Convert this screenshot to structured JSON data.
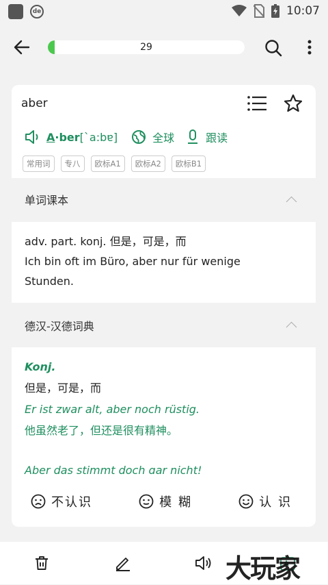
{
  "status": {
    "time": "10:07",
    "app_badge": "de"
  },
  "header": {
    "progress_count": "29",
    "progress_fraction": 0.035
  },
  "word": {
    "headword": "aber",
    "pronunciation_bold_a": "A",
    "pronunciation_rest": "·ber",
    "ipa": "[`a:bɐ]",
    "global_label": "全球",
    "follow_label": "跟读",
    "tags": [
      "常用词",
      "专八",
      "欧标A1",
      "欧标A2",
      "欧标B1"
    ]
  },
  "textbook": {
    "title": "单词课本",
    "line1": "adv. part. konj. 但是，可是，而",
    "line2": "Ich bin oft im Büro, aber nur für wenige",
    "line3": "Stunden."
  },
  "dictionary": {
    "title": "德汉-汉德词典",
    "pos": "Konj.",
    "meaning": "但是，可是，而",
    "example_de": "Er ist zwar alt, aber noch rüstig.",
    "example_zh": "他虽然老了，但还是很有精神。",
    "example2_de": "Aber das stimmt doch gar nicht!"
  },
  "actions": {
    "unknown": "不认识",
    "vague": "模 糊",
    "known": "认 识"
  },
  "watermark": "大玩家",
  "colors": {
    "accent": "#1f8f5f",
    "progress": "#4cc84e"
  }
}
